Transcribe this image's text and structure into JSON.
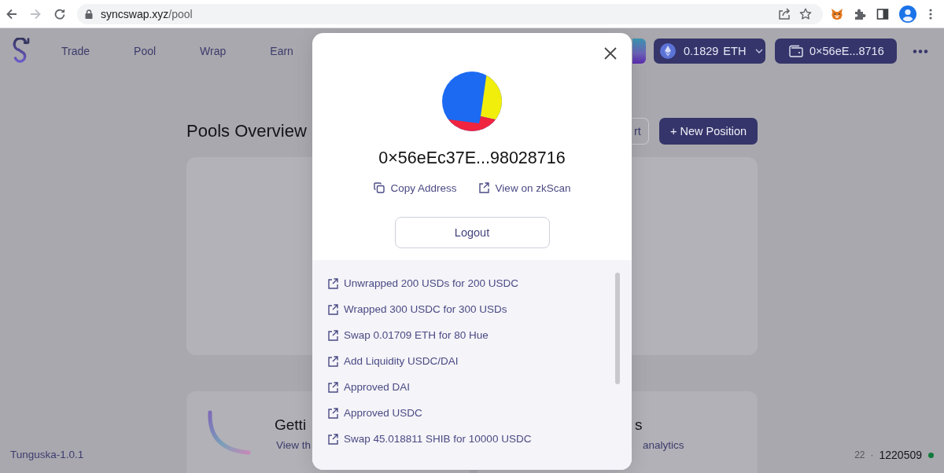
{
  "browser": {
    "url_host": "syncswap.xyz",
    "url_path": "/pool",
    "forward_enabled": false
  },
  "nav": {
    "items": [
      {
        "label": "Trade"
      },
      {
        "label": "Pool"
      },
      {
        "label": "Wrap"
      },
      {
        "label": "Earn"
      }
    ],
    "balance": {
      "amount": "0.1829",
      "symbol": "ETH"
    },
    "wallet": {
      "address": "0×56eE...8716"
    }
  },
  "page": {
    "title": "Pools Overview",
    "import_button": "rt",
    "new_position_button": "+ New Position",
    "cards": [
      {
        "title": "Getti",
        "text": "View th"
      },
      {
        "title": "s",
        "text": "analytics"
      }
    ]
  },
  "footer": {
    "version": "Tunguska-1.0.1",
    "gas": "22",
    "separator": "·",
    "block": "1220509",
    "connected": true
  },
  "modal": {
    "address": "0×56eEc37E...98028716",
    "actions": [
      {
        "kind": "copy",
        "label": "Copy Address"
      },
      {
        "kind": "explorer",
        "label": "View on zkScan"
      }
    ],
    "logout": "Logout",
    "transactions": [
      {
        "label": "Unwrapped 200 USDs for 200 USDC"
      },
      {
        "label": "Wrapped 300 USDC for 300 USDs"
      },
      {
        "label": "Swap 0.01709 ETH for 80 Hue"
      },
      {
        "label": "Add Liquidity USDC/DAI"
      },
      {
        "label": "Approved DAI"
      },
      {
        "label": "Approved USDC"
      },
      {
        "label": "Swap 45.018811 SHIB for 10000 USDC"
      }
    ]
  }
}
